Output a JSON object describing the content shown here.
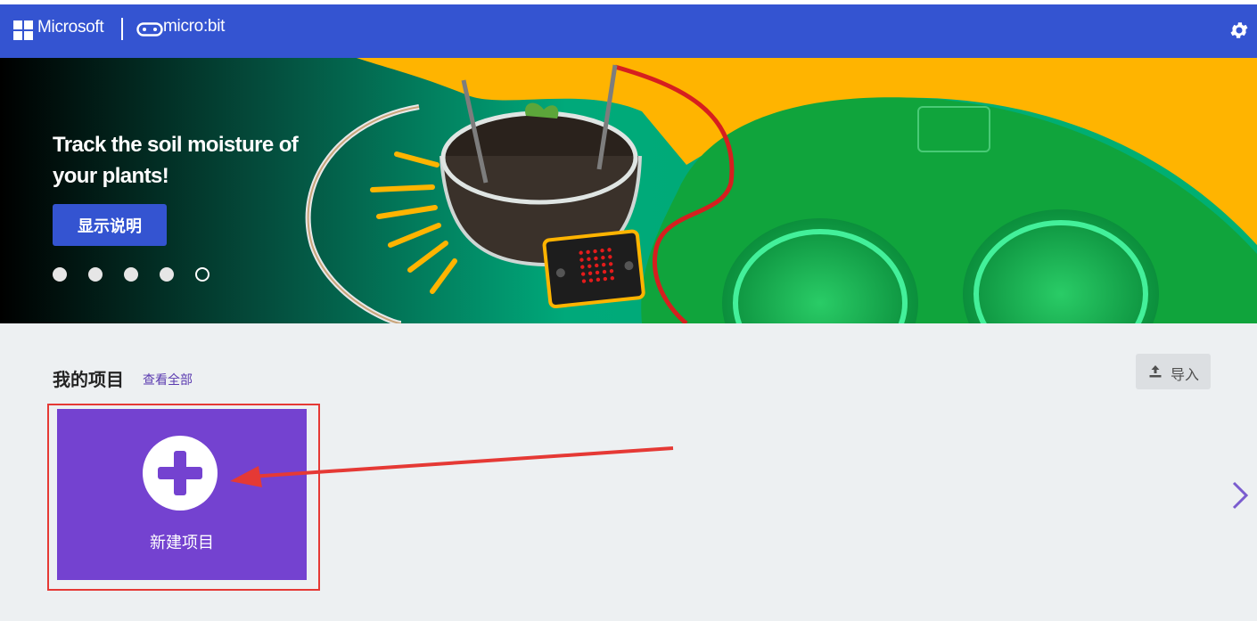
{
  "header": {
    "brand": "Microsoft",
    "product": "micro:bit",
    "bg_color": "#3454d1"
  },
  "hero": {
    "title": "Track the soil moisture of your plants!",
    "button_label": "显示说明",
    "carousel_dots": [
      {
        "state": "filled"
      },
      {
        "state": "filled"
      },
      {
        "state": "filled"
      },
      {
        "state": "filled"
      },
      {
        "state": "active-outline"
      }
    ],
    "colors": {
      "accent_green": "#00a97a",
      "accent_yellow": "#ffb400"
    }
  },
  "projects": {
    "title": "我的项目",
    "view_all": "查看全部",
    "import_label": "导入",
    "new_project_label": "新建项目",
    "card_color": "#7442d0",
    "highlight_color": "#e53935"
  },
  "icons": {
    "settings": "gear-icon",
    "import": "upload-icon",
    "new": "plus-icon",
    "next": "chevron-right-icon"
  }
}
